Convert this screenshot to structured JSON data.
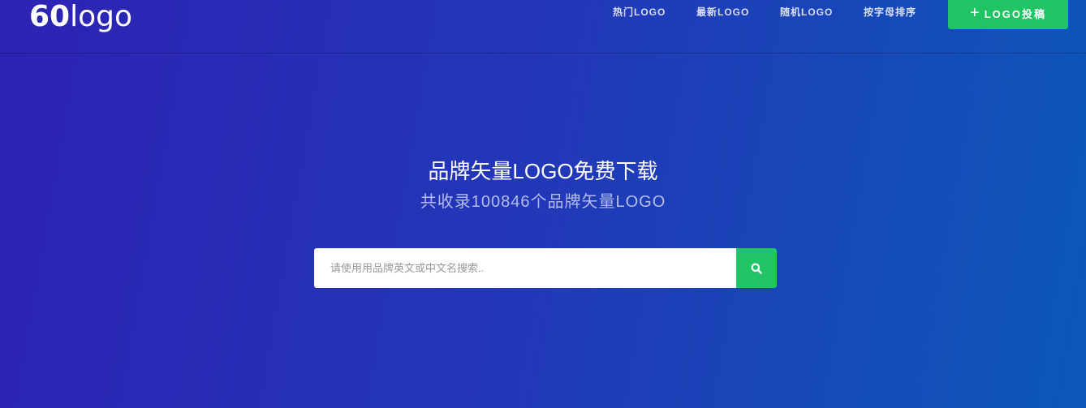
{
  "header": {
    "logo_bold": "60",
    "logo_light": "logo",
    "nav": [
      {
        "label": "热门LOGO"
      },
      {
        "label": "最新LOGO"
      },
      {
        "label": "随机LOGO"
      },
      {
        "label": "按字母排序"
      }
    ],
    "submit_icon": "+",
    "submit_label": "LOGO投稿"
  },
  "hero": {
    "title": "品牌矢量LOGO免费下载",
    "subtitle": "共收录100846个品牌矢量LOGO"
  },
  "search": {
    "placeholder": "请使用用品牌英文或中文名搜索..",
    "value": ""
  },
  "colors": {
    "accent": "#21c465",
    "bg_start": "#2d22b3",
    "bg_end": "#0c58b8"
  }
}
